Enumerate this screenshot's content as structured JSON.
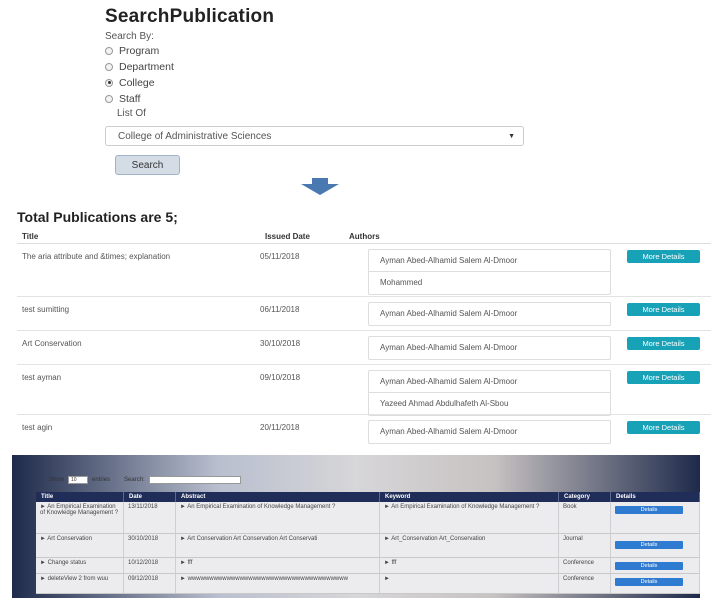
{
  "search": {
    "title": "SearchPublication",
    "search_by_label": "Search By:",
    "options": [
      {
        "label": "Program",
        "checked": false
      },
      {
        "label": "Department",
        "checked": false
      },
      {
        "label": "College",
        "checked": true
      },
      {
        "label": "Staff",
        "checked": false
      }
    ],
    "list_of_label": "List Of",
    "selected_value": "College of Administrative Sciences",
    "search_button": "Search"
  },
  "results": {
    "total_title": "Total Publications are 5;",
    "columns": [
      "Title",
      "Issued Date",
      "Authors"
    ],
    "more_details_label": "More Details",
    "accent_color": "#17a2b8",
    "rows": [
      {
        "title": "The aria attribute and &times; explanation",
        "date": "05/11/2018",
        "authors": [
          "Ayman Abed-Alhamid Salem Al-Dmoor",
          "Mohammed"
        ]
      },
      {
        "title": "test sumitting",
        "date": "06/11/2018",
        "authors": [
          "Ayman Abed-Alhamid Salem Al-Dmoor"
        ]
      },
      {
        "title": "Art Conservation",
        "date": "30/10/2018",
        "authors": [
          "Ayman Abed-Alhamid Salem Al-Dmoor"
        ]
      },
      {
        "title": "test ayman",
        "date": "09/10/2018",
        "authors": [
          "Ayman Abed-Alhamid Salem Al-Dmoor",
          "Yazeed Ahmad Abdulhafeth Al-Sbou"
        ]
      },
      {
        "title": "test agin",
        "date": "20/11/2018",
        "authors": [
          "Ayman Abed-Alhamid Salem Al-Dmoor"
        ]
      }
    ]
  },
  "bottom": {
    "show_label": "Show",
    "show_value": "10",
    "entries_label": "entries",
    "search_label": "Search:",
    "columns": [
      "Title",
      "Date",
      "Abstract",
      "Keyword",
      "Category",
      "Details"
    ],
    "details_label": "Details",
    "rows": [
      {
        "title": "► An Empirical Examination of Knowledge Management ?",
        "date": "13/11/2018",
        "abstract": "► An Empirical Examination of Knowledge Management ?",
        "keyword": "► An Empirical Examination of Knowledge Management ?",
        "category": "Book"
      },
      {
        "title": "► Art Conservation",
        "date": "30/10/2018",
        "abstract": "► Art Conservation Art Conservation Art Conservati",
        "keyword": "► Art_Conservation   Art_Conservation",
        "category": "Journal"
      },
      {
        "title": "► Change status",
        "date": "10/12/2018",
        "abstract": "► fff",
        "keyword": "► fff",
        "category": "Conference"
      },
      {
        "title": "► deleteView 2 from wuu",
        "date": "09/12/2018",
        "abstract": "► wwwwwwwwwwwwwwwwwwwwwwwwwwwwwwwwwwwww",
        "keyword": "►",
        "category": "Conference"
      }
    ]
  }
}
